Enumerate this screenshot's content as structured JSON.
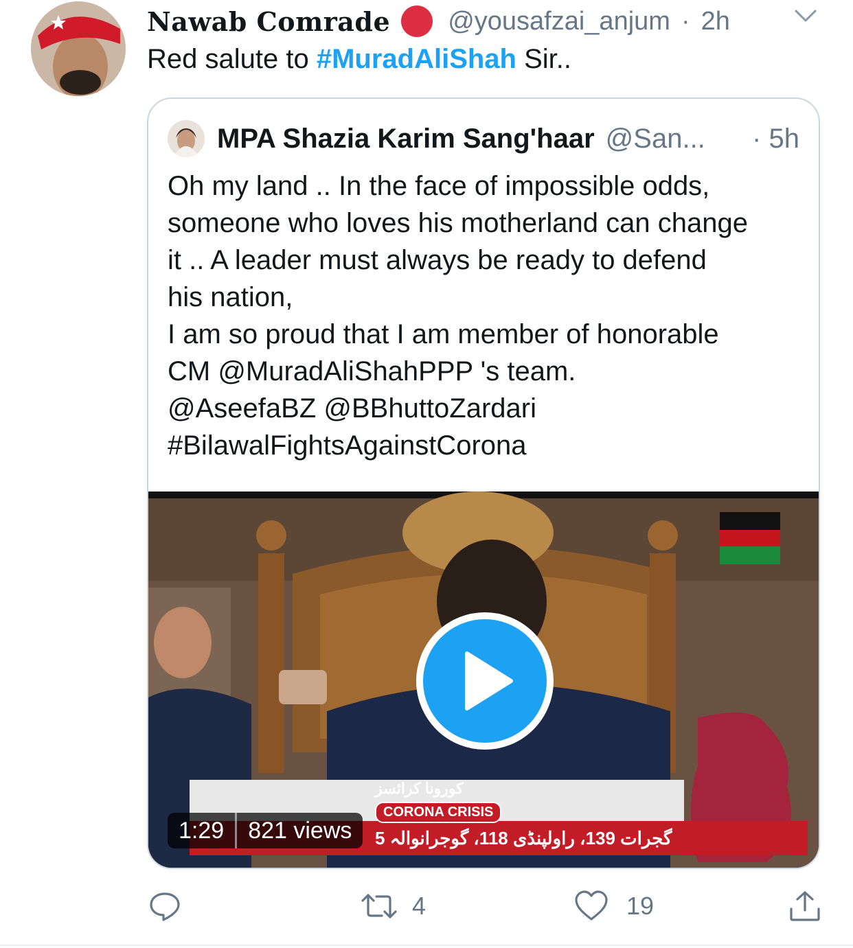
{
  "tweet": {
    "display_name": "Nawab Comrade",
    "handle": "@yousafzai_anjum",
    "separator": "·",
    "time": "2h",
    "text_before": "Red salute to ",
    "hashtag": "#MuradAliShah",
    "text_after": " Sir.."
  },
  "quoted": {
    "display_name": "MPA Shazia Karim Sang'haar",
    "handle": "@San...",
    "separator": "·",
    "time": "5h",
    "lines": [
      "Oh my land .. In the face of impossible odds,",
      "someone who loves his motherland can change",
      "it .. A leader must always be ready to defend",
      "his nation,",
      "I am so proud that I am member of honorable",
      "CM @MuradAliShahPPP 's team.",
      "@AseefaBZ @BBhuttoZardari",
      "#BilawalFightsAgainstCorona"
    ],
    "video": {
      "duration": "1:29",
      "views": "821 views",
      "ticker_urdu": "کورونا کرائسز",
      "ticker_label": "CORONA CRISIS",
      "ticker_numbers": "گجرات 139، راولپنڈی 118، گوجرانوالہ 5"
    }
  },
  "actions": {
    "reply_icon": "reply-icon",
    "retweet_icon": "retweet-icon",
    "retweet_count": "4",
    "like_icon": "heart-icon",
    "like_count": "19",
    "share_icon": "share-icon"
  },
  "colors": {
    "accent": "#1da1f2",
    "muted": "#657786",
    "text": "#14171a",
    "border": "#ccd6dd"
  }
}
